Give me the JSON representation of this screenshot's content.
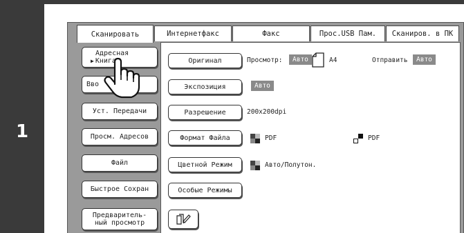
{
  "step_number": "1",
  "tabs": [
    "Сканировать",
    "Интернетфакс",
    "Факс",
    "Прос.USB Пам.",
    "Сканиров. в ПК"
  ],
  "left_buttons": {
    "address_book_line1": "Адресная",
    "address_book_line2": "Книга",
    "input": "Вво     а",
    "transfer_settings": "Уст. Передачи",
    "address_review": "Просм. Адресов",
    "file": "Файл",
    "quick_save": "Быстрое Сохран",
    "preview_line1": "Предваритель-",
    "preview_line2": "ный просмотр"
  },
  "settings": {
    "original": {
      "label": "Оригинал",
      "view_label": "Просмотр:",
      "view_value": "Авто",
      "paper": "A4",
      "send_label": "Отправить",
      "send_value": "Авто"
    },
    "exposure": {
      "label": "Экспозиция",
      "value": "Авто"
    },
    "resolution": {
      "label": "Разрешение",
      "value": "200x200dpi"
    },
    "file_format": {
      "label": "Формат Файла",
      "value_color": "PDF",
      "value_bw": "PDF"
    },
    "color_mode": {
      "label": "Цветной Режим",
      "value": "Авто/Полутон."
    },
    "special_modes": {
      "label": "Особые Режимы"
    }
  },
  "icons": {
    "pointer": "hand-pointer-icon",
    "paper": "paper-sheet-icon",
    "mosaic": "color-mosaic-icon",
    "bw": "bw-mosaic-icon",
    "misc": "document-pen-icon"
  }
}
